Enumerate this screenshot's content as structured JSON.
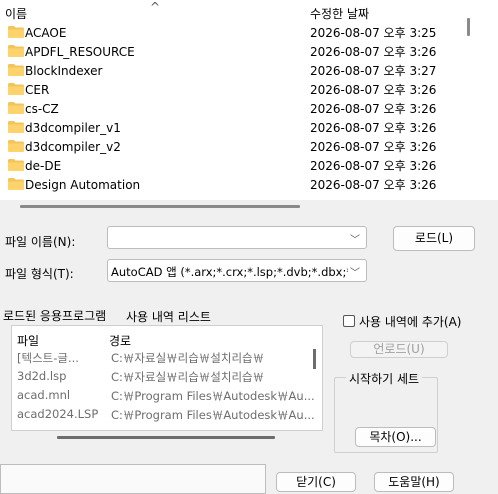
{
  "file_list": {
    "col_name": "이름",
    "col_date": "수정한 날짜",
    "sort_indicator": "^",
    "folder_color": "#f2c55c",
    "rows": [
      {
        "name": "ACAOE",
        "date": "2026-08-07 오후 3:25"
      },
      {
        "name": "APDFL_RESOURCE",
        "date": "2026-08-07 오후 3:26"
      },
      {
        "name": "BlockIndexer",
        "date": "2026-08-07 오후 3:27"
      },
      {
        "name": "CER",
        "date": "2026-08-07 오후 3:26"
      },
      {
        "name": "cs-CZ",
        "date": "2026-08-07 오후 3:26"
      },
      {
        "name": "d3dcompiler_v1",
        "date": "2026-08-07 오후 3:26"
      },
      {
        "name": "d3dcompiler_v2",
        "date": "2026-08-07 오후 3:26"
      },
      {
        "name": "de-DE",
        "date": "2026-08-07 오후 3:26"
      },
      {
        "name": "Design Automation",
        "date": "2026-08-07 오후 3:26"
      }
    ]
  },
  "file_name": {
    "label": "파일 이름(N):",
    "value": ""
  },
  "file_type": {
    "label": "파일 형식(T):",
    "value": "AutoCAD 앱 (*.arx;*.crx;*.lsp;*.dvb;*.dbx;*.vlx;"
  },
  "load_button": "로드(L)",
  "tabs": {
    "loaded": "로드된 응용프로그램",
    "history": "사용 내역 리스트"
  },
  "add_history": "사용 내역에 추가(A)",
  "unload_button": "언로드(U)",
  "startup_group": "시작하기 세트",
  "contents_button": "목차(O)...",
  "apps": {
    "col_file": "파일",
    "col_path": "경로",
    "rows": [
      {
        "file": "[텍스트-글...",
        "path": "C:￦자료실￦리습￦설치리습￦"
      },
      {
        "file": "3d2d.lsp",
        "path": "C:￦자료실￦리습￦설치리습￦"
      },
      {
        "file": "acad.mnl",
        "path": "C:￦Program Files￦Autodesk￦Au..."
      },
      {
        "file": "acad2024.LSP",
        "path": "C:￦Program Files￦Autodesk￦Au..."
      }
    ]
  },
  "close_button": "닫기(C)",
  "help_button": "도움말(H)"
}
